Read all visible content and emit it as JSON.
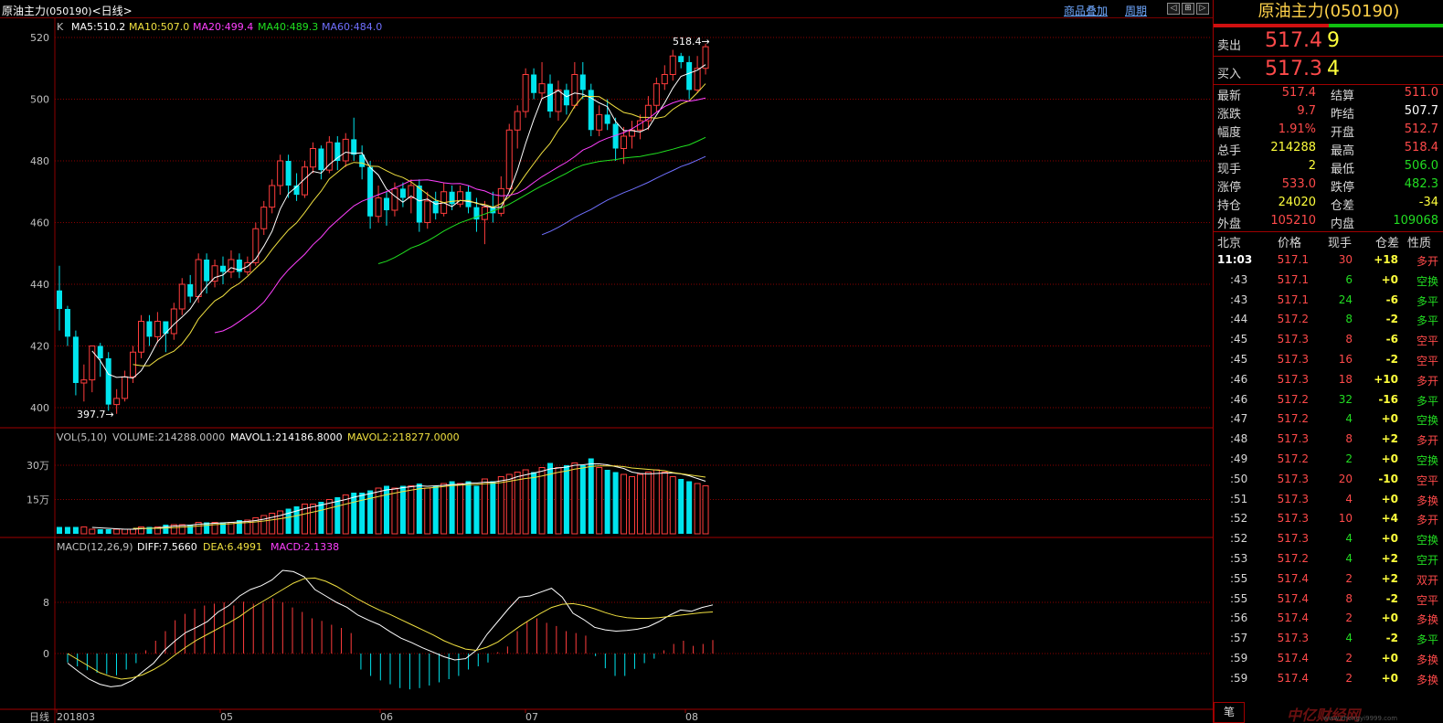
{
  "title": {
    "name": "原油主力",
    "code": "(050190)",
    "period": "<日线>"
  },
  "toolbar": {
    "overlay_label": "商品叠加",
    "period_label": "周期",
    "btn_left": "◁",
    "btn_sync": "⊞",
    "btn_right": "▷"
  },
  "colors": {
    "up": "#ff3c3c",
    "down": "#00e5ee",
    "ma5": "#ffffff",
    "ma10": "#f0e040",
    "ma20": "#ff40ff",
    "ma40": "#20e020",
    "ma60": "#7070ff",
    "grid": "#8b0000"
  },
  "main_panel": {
    "legend_k": "K",
    "ma5": "MA5:510.2",
    "ma10": "MA10:507.0",
    "ma20": "MA20:499.4",
    "ma40": "MA40:489.3",
    "ma60": "MA60:484.0",
    "high_label": "518.4→",
    "low_label": "397.7→",
    "y_ticks": [
      "520",
      "500",
      "480",
      "460",
      "440",
      "420",
      "400"
    ]
  },
  "vol_panel": {
    "legend_name": "VOL(5,10)",
    "volume": "VOLUME:214288.0000",
    "mavol1": "MAVOL1:214186.8000",
    "mavol2": "MAVOL2:218277.0000",
    "y_ticks": [
      "30万",
      "15万"
    ]
  },
  "macd_panel": {
    "legend_name": "MACD(12,26,9)",
    "diff": "DIFF:7.5660",
    "dea": "DEA:6.4991",
    "macd": "MACD:2.1338",
    "y_ticks": [
      "8",
      "0"
    ]
  },
  "x_axis": {
    "period_label": "日线",
    "ticks": [
      "201803",
      "05",
      "06",
      "07",
      "08"
    ]
  },
  "chart_data": {
    "type": "candlestick",
    "y_range": [
      395,
      522
    ],
    "candles": [
      [
        438,
        432,
        446,
        425
      ],
      [
        432,
        423,
        433,
        420
      ],
      [
        423,
        408,
        425,
        404
      ],
      [
        408,
        409,
        414,
        402
      ],
      [
        409,
        420,
        420,
        405
      ],
      [
        420,
        416,
        421,
        410
      ],
      [
        416,
        401,
        418,
        399
      ],
      [
        401,
        403,
        406,
        398
      ],
      [
        403,
        410,
        412,
        402
      ],
      [
        410,
        418,
        420,
        408
      ],
      [
        418,
        428,
        430,
        416
      ],
      [
        428,
        423,
        430,
        420
      ],
      [
        423,
        428,
        431,
        421
      ],
      [
        428,
        424,
        428,
        418
      ],
      [
        424,
        432,
        434,
        422
      ],
      [
        432,
        440,
        442,
        430
      ],
      [
        440,
        436,
        443,
        434
      ],
      [
        436,
        448,
        450,
        434
      ],
      [
        448,
        441,
        450,
        437
      ],
      [
        441,
        446,
        448,
        439
      ],
      [
        446,
        444,
        449,
        440
      ],
      [
        444,
        448,
        451,
        442
      ],
      [
        448,
        444,
        450,
        442
      ],
      [
        444,
        447,
        449,
        443
      ],
      [
        447,
        458,
        460,
        446
      ],
      [
        458,
        465,
        467,
        456
      ],
      [
        465,
        472,
        474,
        463
      ],
      [
        472,
        480,
        482,
        469
      ],
      [
        480,
        472,
        482,
        468
      ],
      [
        472,
        469,
        476,
        467
      ],
      [
        469,
        478,
        480,
        468
      ],
      [
        478,
        484,
        486,
        476
      ],
      [
        484,
        477,
        485,
        474
      ],
      [
        477,
        486,
        488,
        476
      ],
      [
        486,
        480,
        488,
        477
      ],
      [
        480,
        487,
        489,
        478
      ],
      [
        487,
        482,
        494,
        480
      ],
      [
        482,
        478,
        485,
        474
      ],
      [
        478,
        462,
        480,
        458
      ],
      [
        462,
        468,
        472,
        460
      ],
      [
        468,
        464,
        470,
        459
      ],
      [
        464,
        471,
        473,
        462
      ],
      [
        471,
        468,
        473,
        465
      ],
      [
        468,
        472,
        474,
        463
      ],
      [
        472,
        460,
        474,
        457
      ],
      [
        460,
        467,
        470,
        458
      ],
      [
        467,
        463,
        470,
        461
      ],
      [
        463,
        470,
        473,
        462
      ],
      [
        470,
        466,
        472,
        464
      ],
      [
        466,
        470,
        472,
        465
      ],
      [
        470,
        465,
        472,
        463
      ],
      [
        465,
        461,
        468,
        457
      ],
      [
        461,
        465,
        467,
        453
      ],
      [
        465,
        463,
        470,
        460
      ],
      [
        463,
        471,
        475,
        462
      ],
      [
        471,
        490,
        492,
        470
      ],
      [
        490,
        496,
        498,
        484
      ],
      [
        496,
        508,
        510,
        494
      ],
      [
        508,
        502,
        510,
        500
      ],
      [
        502,
        505,
        512,
        500
      ],
      [
        505,
        496,
        508,
        494
      ],
      [
        496,
        503,
        506,
        493
      ],
      [
        503,
        498,
        505,
        495
      ],
      [
        498,
        508,
        512,
        497
      ],
      [
        508,
        503,
        512,
        500
      ],
      [
        503,
        490,
        505,
        488
      ],
      [
        490,
        495,
        498,
        488
      ],
      [
        495,
        492,
        500,
        490
      ],
      [
        492,
        484,
        494,
        480
      ],
      [
        484,
        488,
        491,
        479
      ],
      [
        488,
        490,
        493,
        484
      ],
      [
        490,
        493,
        495,
        487
      ],
      [
        493,
        498,
        501,
        490
      ],
      [
        498,
        505,
        507,
        496
      ],
      [
        505,
        508,
        511,
        503
      ],
      [
        508,
        514,
        516,
        506
      ],
      [
        514,
        512,
        515,
        510
      ],
      [
        512,
        503,
        514,
        500
      ],
      [
        503,
        510,
        514,
        502
      ],
      [
        510,
        517,
        518,
        508
      ]
    ],
    "volumes": [
      3,
      3,
      3,
      3,
      2,
      2,
      2,
      2,
      2,
      2,
      3,
      3,
      3,
      4,
      4,
      4,
      4,
      5,
      5,
      5,
      5,
      5,
      6,
      6,
      7,
      8,
      9,
      10,
      11,
      12,
      13,
      13,
      14,
      15,
      16,
      17,
      18,
      18,
      19,
      20,
      21,
      20,
      21,
      21,
      22,
      20,
      21,
      22,
      23,
      22,
      23,
      21,
      24,
      23,
      25,
      26,
      27,
      28,
      27,
      29,
      31,
      29,
      30,
      31,
      30,
      33,
      29,
      28,
      27,
      26,
      25,
      26,
      27,
      28,
      27,
      25,
      24,
      23,
      22,
      21
    ],
    "macd": [
      -1.4,
      -2,
      -2.6,
      -3,
      -3.2,
      -3.4,
      -2.5,
      -1.5,
      0.5,
      2,
      3.5,
      5.2,
      6.2,
      7,
      7.5,
      7.8,
      8,
      7.5,
      8.1,
      7.8,
      7.9,
      8.6,
      8,
      7.2,
      6.5,
      5.5,
      5.1,
      4.5,
      4,
      3.2,
      -2.5,
      -3.5,
      -4.2,
      -4.8,
      -5.4,
      -5.6,
      -5.4,
      -5,
      -4.5,
      -4,
      -3.5,
      -2.5,
      -2,
      -1.4,
      0.2,
      1.1,
      3.5,
      5,
      5.5,
      4.8,
      4.3,
      3.5,
      3.2,
      2.8,
      -0.4,
      -2.3,
      -3.5,
      -3.5,
      -2.4,
      -1.5,
      -0.8,
      0.5,
      1.5,
      2,
      1.2,
      1.5,
      2.1
    ],
    "diff_line": [
      -1.5,
      -2.8,
      -4,
      -4.8,
      -5.2,
      -5,
      -4.2,
      -2.8,
      -1.5,
      0.5,
      2,
      3.3,
      4.1,
      5,
      6.5,
      7.5,
      9,
      10,
      10.6,
      11.5,
      13,
      12.8,
      12,
      10,
      9,
      8,
      7.2,
      6,
      5.2,
      4.5,
      3.4,
      2.4,
      1.7,
      0.9,
      0.2,
      -0.5,
      -1,
      -0.8,
      0.5,
      3,
      5,
      7,
      8.8,
      9,
      9.6,
      10.2,
      8.8,
      6.3,
      5.3,
      4.1,
      3.7,
      3.5,
      3.6,
      3.8,
      4.2,
      5,
      6,
      6.8,
      6.6,
      7.2,
      7.6
    ],
    "dea_line": [
      0,
      -1,
      -2,
      -3,
      -3.6,
      -4,
      -3.8,
      -3.3,
      -2.5,
      -1.5,
      -0.2,
      1,
      2.1,
      3,
      3.9,
      4.8,
      5.8,
      7,
      8,
      9,
      10,
      11,
      11.7,
      11.8,
      11.3,
      10.5,
      9.5,
      8.5,
      7.6,
      6.8,
      6.1,
      5.3,
      4.5,
      3.7,
      2.9,
      2,
      1.3,
      0.7,
      0.5,
      1,
      1.8,
      3,
      4.2,
      5.3,
      6.3,
      7.2,
      7.7,
      7.8,
      7.5,
      7,
      6.4,
      5.9,
      5.6,
      5.5,
      5.5,
      5.6,
      5.8,
      6,
      6.2,
      6.4,
      6.5
    ]
  },
  "right_panel": {
    "title": "原油主力(050190)",
    "sell_label": "卖出",
    "sell_price": "517.4",
    "sell_qty": "9",
    "buy_label": "买入",
    "buy_price": "517.3",
    "buy_qty": "4",
    "quote_rows": [
      {
        "l1": "最新",
        "v1": "517.4",
        "c1": "up",
        "l2": "结算",
        "v2": "511.0",
        "c2": "up"
      },
      {
        "l1": "涨跌",
        "v1": "9.7",
        "c1": "up",
        "l2": "昨结",
        "v2": "507.7",
        "c2": "wh"
      },
      {
        "l1": "幅度",
        "v1": "1.91%",
        "c1": "up",
        "l2": "开盘",
        "v2": "512.7",
        "c2": "up"
      },
      {
        "l1": "总手",
        "v1": "214288",
        "c1": "yl",
        "l2": "最高",
        "v2": "518.4",
        "c2": "up"
      },
      {
        "l1": "现手",
        "v1": "2",
        "c1": "yl",
        "l2": "最低",
        "v2": "506.0",
        "c2": "dn"
      },
      {
        "l1": "涨停",
        "v1": "533.0",
        "c1": "up",
        "l2": "跌停",
        "v2": "482.3",
        "c2": "dn"
      },
      {
        "l1": "持仓",
        "v1": "24020",
        "c1": "yl",
        "l2": "仓差",
        "v2": "-34",
        "c2": "yl"
      },
      {
        "l1": "外盘",
        "v1": "105210",
        "c1": "up",
        "l2": "内盘",
        "v2": "109068",
        "c2": "dn"
      }
    ],
    "tick_headers": {
      "time": "北京",
      "price": "价格",
      "qty": "现手",
      "diff": "仓差",
      "nature": "性质"
    },
    "ticks": [
      {
        "time": "11:03",
        "price": "517.1",
        "qty": "30",
        "diff": "+18",
        "nature": "多开",
        "dir": "up"
      },
      {
        "time": ":43",
        "price": "517.1",
        "qty": "6",
        "diff": "+0",
        "nature": "空换",
        "dir": "dn"
      },
      {
        "time": ":43",
        "price": "517.1",
        "qty": "24",
        "diff": "-6",
        "nature": "多平",
        "dir": "dn"
      },
      {
        "time": ":44",
        "price": "517.2",
        "qty": "8",
        "diff": "-2",
        "nature": "多平",
        "dir": "dn"
      },
      {
        "time": ":45",
        "price": "517.3",
        "qty": "8",
        "diff": "-6",
        "nature": "空平",
        "dir": "up"
      },
      {
        "time": ":45",
        "price": "517.3",
        "qty": "16",
        "diff": "-2",
        "nature": "空平",
        "dir": "up"
      },
      {
        "time": ":46",
        "price": "517.3",
        "qty": "18",
        "diff": "+10",
        "nature": "多开",
        "dir": "up"
      },
      {
        "time": ":46",
        "price": "517.2",
        "qty": "32",
        "diff": "-16",
        "nature": "多平",
        "dir": "dn"
      },
      {
        "time": ":47",
        "price": "517.2",
        "qty": "4",
        "diff": "+0",
        "nature": "空换",
        "dir": "dn"
      },
      {
        "time": ":48",
        "price": "517.3",
        "qty": "8",
        "diff": "+2",
        "nature": "多开",
        "dir": "up"
      },
      {
        "time": ":49",
        "price": "517.2",
        "qty": "2",
        "diff": "+0",
        "nature": "空换",
        "dir": "dn"
      },
      {
        "time": ":50",
        "price": "517.3",
        "qty": "20",
        "diff": "-10",
        "nature": "空平",
        "dir": "up"
      },
      {
        "time": ":51",
        "price": "517.3",
        "qty": "4",
        "diff": "+0",
        "nature": "多换",
        "dir": "up"
      },
      {
        "time": ":52",
        "price": "517.3",
        "qty": "10",
        "diff": "+4",
        "nature": "多开",
        "dir": "up"
      },
      {
        "time": ":52",
        "price": "517.3",
        "qty": "4",
        "diff": "+0",
        "nature": "空换",
        "dir": "dn"
      },
      {
        "time": ":53",
        "price": "517.2",
        "qty": "4",
        "diff": "+2",
        "nature": "空开",
        "dir": "dn"
      },
      {
        "time": ":55",
        "price": "517.4",
        "qty": "2",
        "diff": "+2",
        "nature": "双开",
        "dir": "up"
      },
      {
        "time": ":55",
        "price": "517.4",
        "qty": "8",
        "diff": "-2",
        "nature": "空平",
        "dir": "up"
      },
      {
        "time": ":56",
        "price": "517.4",
        "qty": "2",
        "diff": "+0",
        "nature": "多换",
        "dir": "up"
      },
      {
        "time": ":57",
        "price": "517.3",
        "qty": "4",
        "diff": "-2",
        "nature": "多平",
        "dir": "dn"
      },
      {
        "time": ":59",
        "price": "517.4",
        "qty": "2",
        "diff": "+0",
        "nature": "多换",
        "dir": "up"
      },
      {
        "time": ":59",
        "price": "517.4",
        "qty": "2",
        "diff": "+0",
        "nature": "多换",
        "dir": "up"
      }
    ],
    "bottom_tab": "笔",
    "logo_text": "中亿财经网",
    "logo_sub": "www.zhongyi9999.com"
  }
}
